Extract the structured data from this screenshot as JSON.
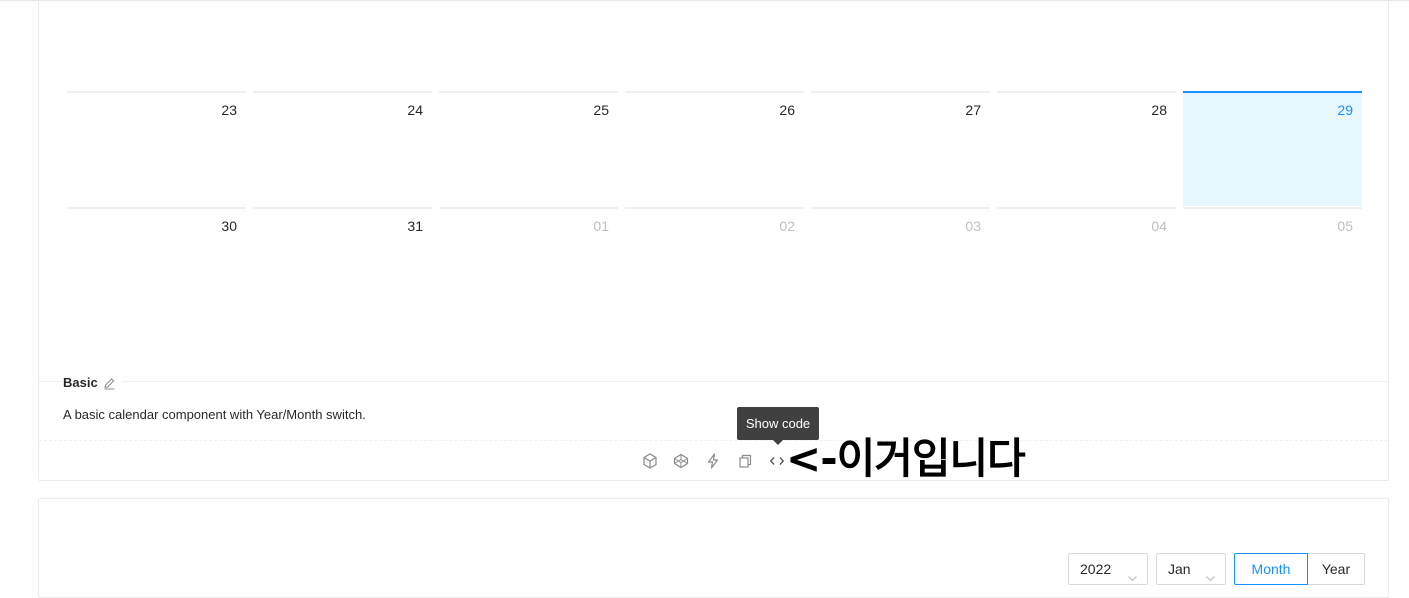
{
  "calendar": {
    "rows": [
      [
        {
          "day": "23",
          "state": "current"
        },
        {
          "day": "24",
          "state": "current"
        },
        {
          "day": "25",
          "state": "current"
        },
        {
          "day": "26",
          "state": "current"
        },
        {
          "day": "27",
          "state": "current"
        },
        {
          "day": "28",
          "state": "current"
        },
        {
          "day": "29",
          "state": "today"
        }
      ],
      [
        {
          "day": "30",
          "state": "current"
        },
        {
          "day": "31",
          "state": "current"
        },
        {
          "day": "01",
          "state": "other"
        },
        {
          "day": "02",
          "state": "other"
        },
        {
          "day": "03",
          "state": "other"
        },
        {
          "day": "04",
          "state": "other"
        },
        {
          "day": "05",
          "state": "other"
        }
      ]
    ]
  },
  "demo": {
    "title": "Basic",
    "description": "A basic calendar component with Year/Month switch.",
    "actions": [
      {
        "name": "codesandbox-icon"
      },
      {
        "name": "codepen-icon"
      },
      {
        "name": "stackblitz-icon"
      },
      {
        "name": "copy-icon"
      },
      {
        "name": "show-code-icon"
      }
    ],
    "tooltip": "Show code"
  },
  "annotation": "<-이거입니다",
  "next_demo": {
    "year_select": "2022",
    "month_select": "Jan",
    "mode_options": [
      "Month",
      "Year"
    ],
    "active_mode": "Month"
  },
  "colors": {
    "primary": "#1890ff",
    "today_bg": "#e6f7ff"
  }
}
